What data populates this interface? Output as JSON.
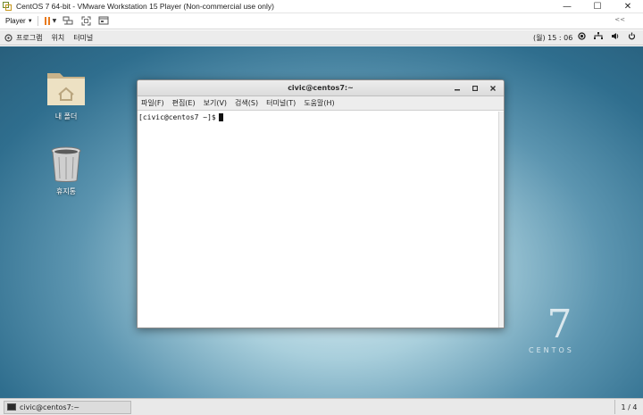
{
  "vmware": {
    "title": "CentOS 7 64-bit - VMware Workstation 15 Player (Non-commercial use only)",
    "player_menu": "Player",
    "window_controls": {
      "minimize": "—",
      "maximize": "☐",
      "close": "✕"
    },
    "toolbar_right": "<<"
  },
  "gnome_bar": {
    "menu": [
      "프로그램",
      "위치",
      "터미널"
    ],
    "clock": "(월) 15 : 06"
  },
  "desktop": {
    "icons": [
      {
        "label": "내 폴더",
        "icon": "home-folder-icon"
      },
      {
        "label": "휴지통",
        "icon": "trash-icon"
      }
    ],
    "brand": {
      "number": "7",
      "word": "CENTOS"
    }
  },
  "terminal": {
    "title": "civic@centos7:~",
    "menu": [
      "파일(F)",
      "편집(E)",
      "보기(V)",
      "검색(S)",
      "터미널(T)",
      "도움말(H)"
    ],
    "prompt": "[civic@centos7 ~]$"
  },
  "taskbar": {
    "item_label": "civic@centos7:~",
    "workspace": "1 / 4"
  },
  "colors": {
    "accent_pause": "#e87a1e",
    "desktop_dark": "#285f7c",
    "desktop_light": "#e3f1f6"
  }
}
